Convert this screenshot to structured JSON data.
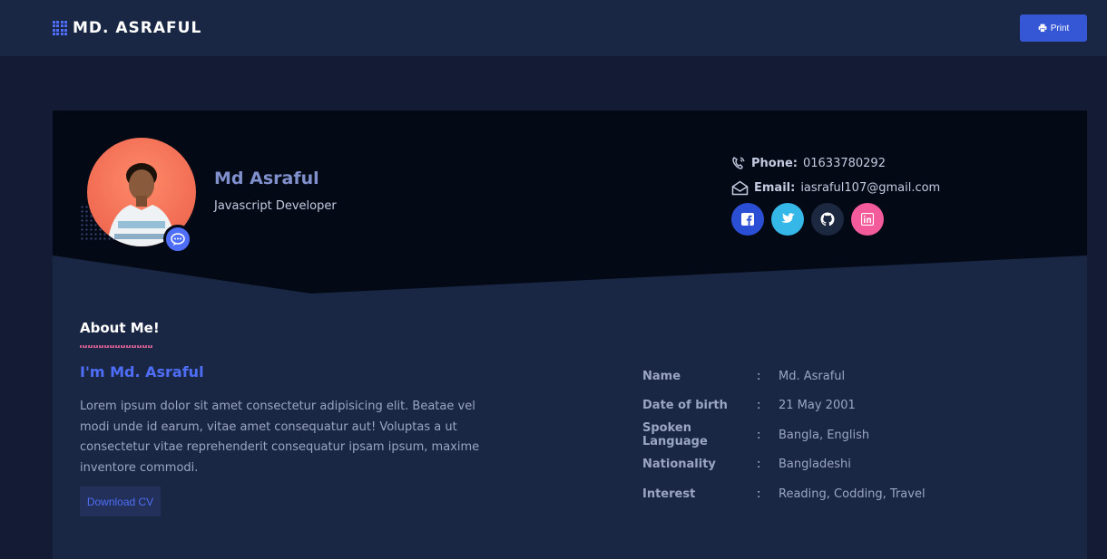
{
  "navbar": {
    "brand": "MD. ASRAFUL",
    "print_label": "Print"
  },
  "profile": {
    "name": "Md Asraful",
    "role": "Javascript Developer"
  },
  "contact": {
    "phone_label": "Phone:",
    "phone_value": "01633780292",
    "email_label": "Email:",
    "email_value": "iasraful107@gmail.com"
  },
  "socials": [
    {
      "icon": "facebook-icon",
      "color": "#2a4fd4"
    },
    {
      "icon": "twitter-icon",
      "color": "#35b8e8"
    },
    {
      "icon": "github-icon",
      "color": "#1c2740"
    },
    {
      "icon": "linkedin-icon",
      "color": "#f45b9a"
    }
  ],
  "about": {
    "heading": "About Me!",
    "intro_title": "I'm Md. Asraful",
    "intro_text": "Lorem ipsum dolor sit amet consectetur adipisicing elit. Beatae vel modi unde id earum, vitae amet consequatur aut! Voluptas a ut consectetur vitae reprehenderit consequatur ipsam ipsum, maxime inventore commodi.",
    "download_label": "Download CV",
    "info": [
      {
        "label": "Name",
        "value": "Md. Asraful"
      },
      {
        "label": "Date of birth",
        "value": "21 May 2001"
      },
      {
        "label": "Spoken Language",
        "value": "Bangla, English"
      },
      {
        "label": "Nationality",
        "value": "Bangladeshi"
      },
      {
        "label": "Interest",
        "value": "Reading, Codding, Travel"
      }
    ],
    "separator": ":"
  },
  "colors": {
    "accent": "#4f6ef7",
    "page_bg": "#141b34",
    "card_bg": "#1a2744",
    "header_bg": "#040916"
  }
}
